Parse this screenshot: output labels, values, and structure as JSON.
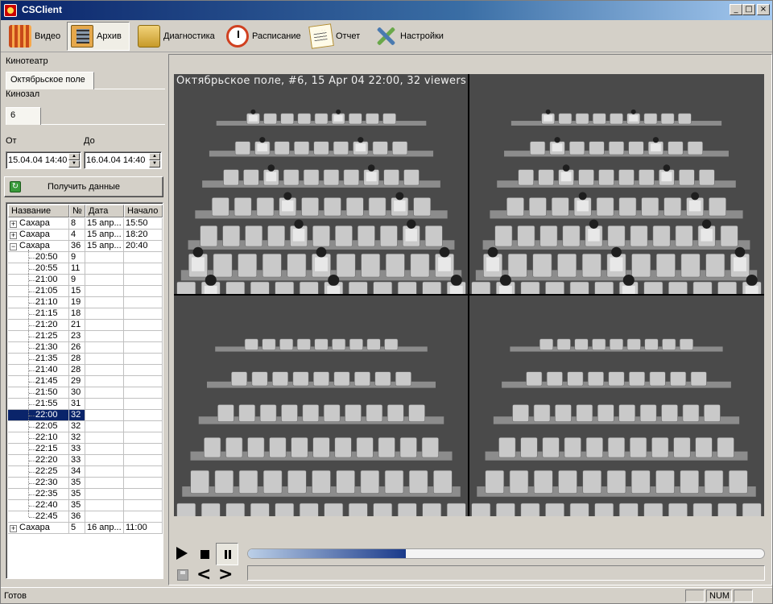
{
  "window": {
    "title": "CSClient",
    "min_glyph": "_",
    "max_glyph": "□",
    "close_glyph": "×"
  },
  "toolbar": {
    "items": [
      {
        "label": "Видео",
        "icon": "video-icon",
        "active": false
      },
      {
        "label": "Архив",
        "icon": "archive-film-icon",
        "active": true
      },
      {
        "label": "Диагностика",
        "icon": "diagnostics-server-icon",
        "active": false
      },
      {
        "label": "Расписание",
        "icon": "schedule-clock-icon",
        "active": false
      },
      {
        "label": "Отчет",
        "icon": "report-document-icon",
        "active": false
      },
      {
        "label": "Настройки",
        "icon": "settings-tools-icon",
        "active": false
      }
    ]
  },
  "left": {
    "cinema_label": "Кинотеатр",
    "cinema_tab": "Октябрьское поле",
    "hall_label": "Кинозал",
    "hall_tab": "6",
    "from_label": "От",
    "to_label": "До",
    "from_value": "15.04.04 14:40",
    "to_value": "16.04.04 14:40",
    "get_button": "Получить данные",
    "get_icon_glyph": "↻"
  },
  "grid": {
    "columns": [
      "Название",
      "№",
      "Дата",
      "Начало"
    ],
    "expand_glyph": "+",
    "collapse_glyph": "−",
    "rows": [
      {
        "name": "Сахара",
        "num": "8",
        "date": "15 апр...",
        "start": "15:50",
        "type": "parent",
        "expanded": false
      },
      {
        "name": "Сахара",
        "num": "4",
        "date": "15 апр...",
        "start": "18:20",
        "type": "parent",
        "expanded": false
      },
      {
        "name": "Сахара",
        "num": "36",
        "date": "15 апр...",
        "start": "20:40",
        "type": "parent",
        "expanded": true
      },
      {
        "name": "20:50",
        "num": "9",
        "type": "child"
      },
      {
        "name": "20:55",
        "num": "11",
        "type": "child"
      },
      {
        "name": "21:00",
        "num": "9",
        "type": "child"
      },
      {
        "name": "21:05",
        "num": "15",
        "type": "child"
      },
      {
        "name": "21:10",
        "num": "19",
        "type": "child"
      },
      {
        "name": "21:15",
        "num": "18",
        "type": "child"
      },
      {
        "name": "21:20",
        "num": "21",
        "type": "child"
      },
      {
        "name": "21:25",
        "num": "23",
        "type": "child"
      },
      {
        "name": "21:30",
        "num": "26",
        "type": "child"
      },
      {
        "name": "21:35",
        "num": "28",
        "type": "child"
      },
      {
        "name": "21:40",
        "num": "28",
        "type": "child"
      },
      {
        "name": "21:45",
        "num": "29",
        "type": "child"
      },
      {
        "name": "21:50",
        "num": "30",
        "type": "child"
      },
      {
        "name": "21:55",
        "num": "31",
        "type": "child"
      },
      {
        "name": "22:00",
        "num": "32",
        "type": "child",
        "selected": true
      },
      {
        "name": "22:05",
        "num": "32",
        "type": "child"
      },
      {
        "name": "22:10",
        "num": "32",
        "type": "child"
      },
      {
        "name": "22:15",
        "num": "33",
        "type": "child"
      },
      {
        "name": "22:20",
        "num": "33",
        "type": "child"
      },
      {
        "name": "22:25",
        "num": "34",
        "type": "child"
      },
      {
        "name": "22:30",
        "num": "35",
        "type": "child"
      },
      {
        "name": "22:35",
        "num": "35",
        "type": "child"
      },
      {
        "name": "22:40",
        "num": "35",
        "type": "child"
      },
      {
        "name": "22:45",
        "num": "36",
        "type": "child"
      },
      {
        "name": "Сахара",
        "num": "5",
        "date": "16 апр...",
        "start": "11:00",
        "type": "parent",
        "expanded": false
      }
    ]
  },
  "video": {
    "osd_text": "Октябрьское поле, #6, 15 Apr 04 22:00, 32 viewers"
  },
  "player": {
    "progress_fraction": 0.305,
    "prev_glyph": "<",
    "next_glyph": ">"
  },
  "status": {
    "text": "Готов",
    "num_indicator": "NUM"
  },
  "colors": {
    "selection": "#0a246a",
    "progress_end": "#1a3a8a"
  }
}
